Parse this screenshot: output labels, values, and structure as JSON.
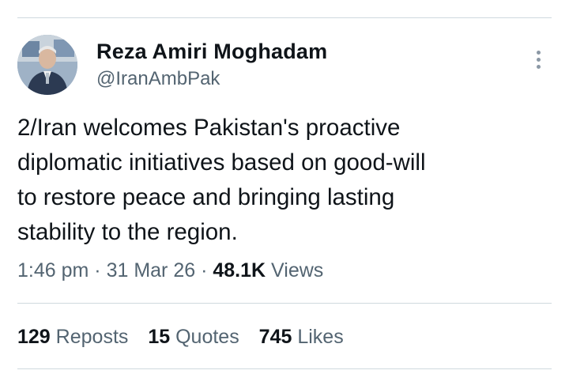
{
  "author": {
    "name": "Reza Amiri Moghadam",
    "handle": "@IranAmbPak"
  },
  "tweet": {
    "text": "2/Iran welcomes Pakistan's proactive\ndiplomatic initiatives based on good-will\nto restore peace and bringing lasting\nstability to the region."
  },
  "meta": {
    "time": "1:46 pm",
    "separator": "·",
    "date": "31 Mar 26",
    "views_count": "48.1K",
    "views_label": "Views"
  },
  "stats": {
    "reposts_count": "129",
    "reposts_label": "Reposts",
    "quotes_count": "15",
    "quotes_label": "Quotes",
    "likes_count": "745",
    "likes_label": "Likes"
  },
  "icons": {
    "more": "more-vertical-icon"
  },
  "colors": {
    "primary_text": "#0f1419",
    "secondary_text": "#536471",
    "divider": "#cfd9de"
  }
}
